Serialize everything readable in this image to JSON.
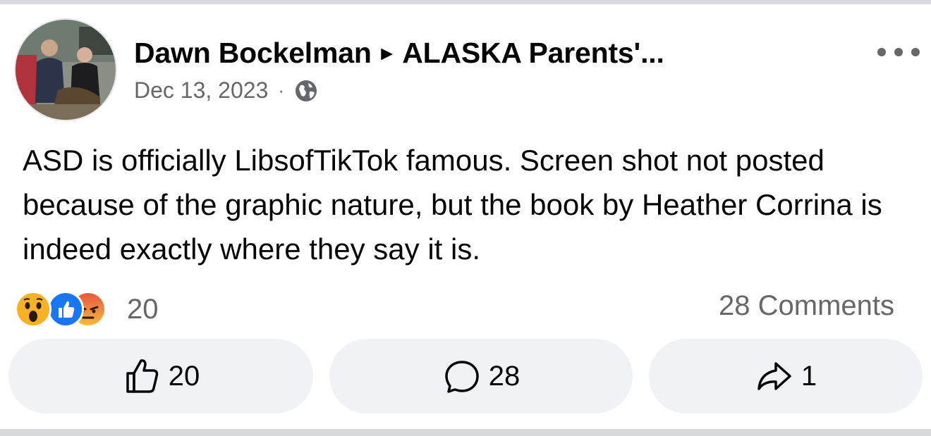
{
  "post": {
    "author": "Dawn Bockelman",
    "separator_icon": "right-triangle-icon",
    "group": "ALASKA Parents'...",
    "date": "Dec 13, 2023",
    "meta_separator": "·",
    "privacy_icon": "globe-icon",
    "more_icon": "more-options-icon",
    "text": "ASD is officially LibsofTikTok famous. Screen shot not posted because of the graphic nature, but the book by Heather Corrina is indeed exactly where they say it is."
  },
  "reactions": {
    "icons": [
      "wow-reaction-icon",
      "like-reaction-icon",
      "angry-reaction-icon"
    ],
    "count": "20"
  },
  "comments_summary": "28 Comments",
  "actions": {
    "like": {
      "icon": "thumbs-up-icon",
      "count": "20"
    },
    "comment": {
      "icon": "comment-bubble-icon",
      "count": "28"
    },
    "share": {
      "icon": "share-arrow-icon",
      "count": "1"
    }
  },
  "colors": {
    "text_primary": "#050505",
    "text_secondary": "#65676b",
    "button_bg": "#f0f2f5",
    "like_blue": "#1877f2",
    "angry_red": "#e9573f",
    "wow_yellow": "#f7b125"
  }
}
